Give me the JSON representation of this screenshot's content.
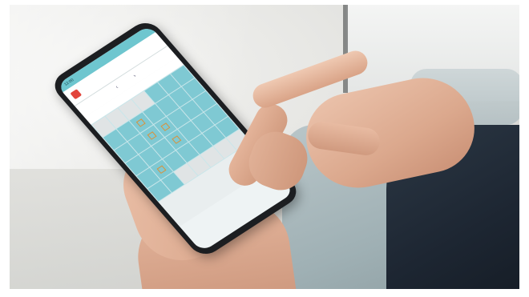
{
  "scene": {
    "description_tag": "hand-holding-smartphone-calendar-app"
  },
  "phone": {
    "status_time": "12:00",
    "status_right": "",
    "app_title": "",
    "month_label": "",
    "nav_prev": "‹",
    "nav_next": "›",
    "weekdays": [
      "",
      "",
      "",
      "",
      "",
      "",
      ""
    ]
  },
  "colors": {
    "accent": "#7fc9d3",
    "header": "#6ec6cf",
    "logo": "#e2453c",
    "marker": "#d9923b"
  }
}
